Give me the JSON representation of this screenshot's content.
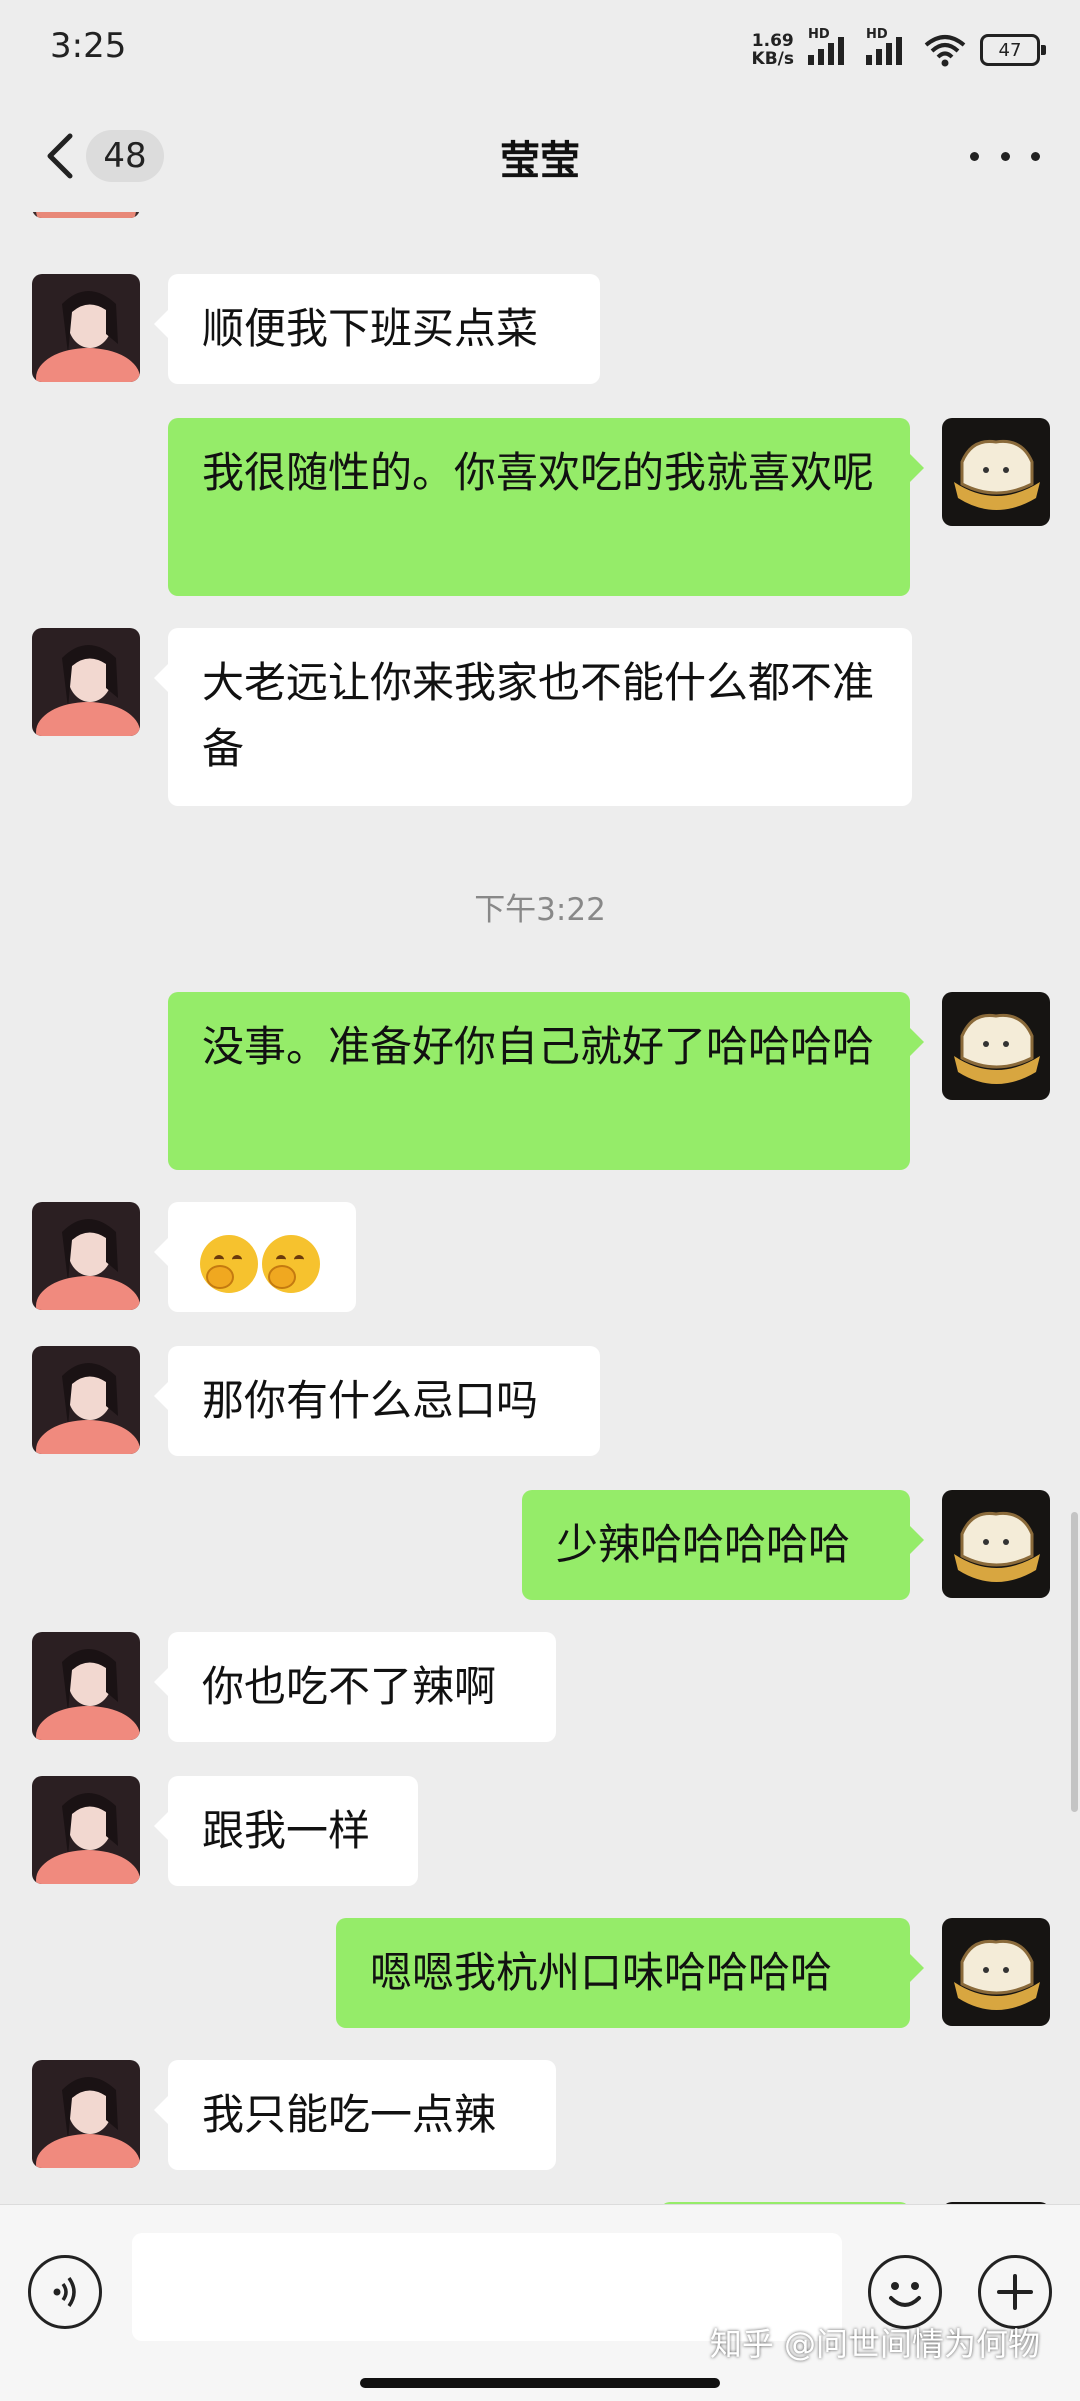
{
  "status_bar": {
    "time": "3:25",
    "speed_value": "1.69",
    "speed_unit": "KB/s",
    "hd1": "HD",
    "hd2": "HD",
    "battery": "47"
  },
  "nav": {
    "unread_count": "48",
    "title": "莹莹"
  },
  "messages": [
    {
      "side": "in",
      "text": "顺便我下班买点菜"
    },
    {
      "side": "out",
      "text": "我很随性的。你喜欢吃的我就喜欢呢"
    },
    {
      "side": "in",
      "text": "大老远让你来我家也不能什么都不准备"
    },
    {
      "side": "time",
      "text": "下午3:22"
    },
    {
      "side": "out",
      "text": "没事。准备好你自己就好了哈哈哈哈"
    },
    {
      "side": "in",
      "emoji": "hugging-face-emoji x2"
    },
    {
      "side": "in",
      "text": "那你有什么忌口吗"
    },
    {
      "side": "out",
      "text": "少辣哈哈哈哈哈"
    },
    {
      "side": "in",
      "text": "你也吃不了辣啊"
    },
    {
      "side": "in",
      "text": "跟我一样"
    },
    {
      "side": "out",
      "text": "嗯嗯我杭州口味哈哈哈哈"
    },
    {
      "side": "in",
      "text": "我只能吃一点辣"
    }
  ],
  "input": {
    "value": "",
    "watermark": "知乎 @问世间情为何物"
  },
  "colors": {
    "background": "#ededed",
    "incoming_bubble": "#ffffff",
    "outgoing_bubble": "#95ec69"
  }
}
